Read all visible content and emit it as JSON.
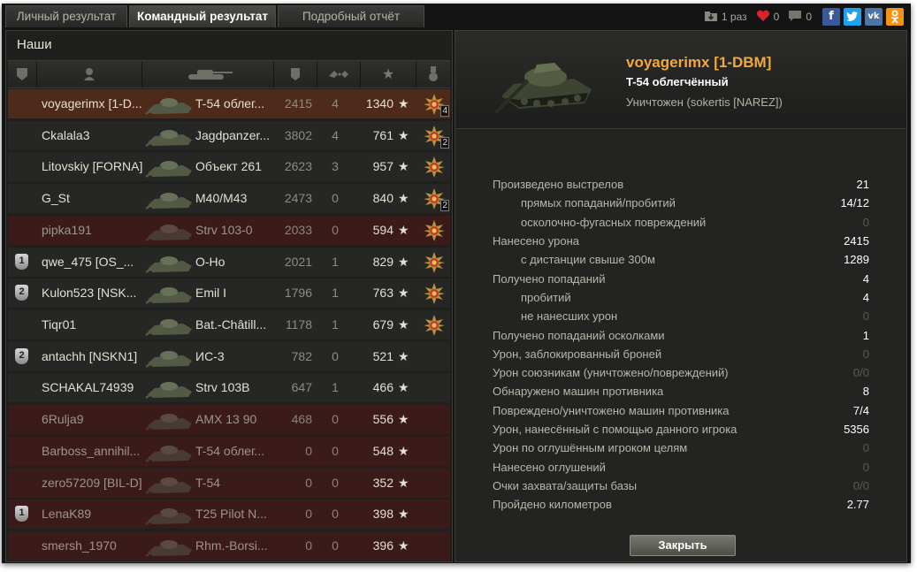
{
  "tabs": [
    "Личный результат",
    "Командный результат",
    "Подробный отчёт"
  ],
  "topbar": {
    "replay_count": "1 раз",
    "likes": "0",
    "comments": "0"
  },
  "team_title": "Наши",
  "players": [
    {
      "name": "voyagerimx [1-D...",
      "vehicle": "T-54 облег...",
      "damage": "2415",
      "frags": "4",
      "xp": "1340",
      "medal": "4",
      "badge": "",
      "status": "selected"
    },
    {
      "name": "Ckalala3",
      "vehicle": "Jagdpanzer...",
      "damage": "3802",
      "frags": "4",
      "xp": "761",
      "medal": "2",
      "badge": "",
      "status": "alive"
    },
    {
      "name": "Litovskiy [FORNA]",
      "vehicle": "Объект 261",
      "damage": "2623",
      "frags": "3",
      "xp": "957",
      "medal": "",
      "badge": "",
      "status": "alive"
    },
    {
      "name": "G_St",
      "vehicle": "M40/M43",
      "damage": "2473",
      "frags": "0",
      "xp": "840",
      "medal": "2",
      "badge": "",
      "status": "alive"
    },
    {
      "name": "pipka191",
      "vehicle": "Strv 103-0",
      "damage": "2033",
      "frags": "0",
      "xp": "594",
      "medal": "",
      "badge": "",
      "status": "dead"
    },
    {
      "name": "qwe_475 [OS_...",
      "vehicle": "O-Ho",
      "damage": "2021",
      "frags": "1",
      "xp": "829",
      "medal": "",
      "badge": "1",
      "status": "alive"
    },
    {
      "name": "Kulon523 [NSK...",
      "vehicle": "Emil I",
      "damage": "1796",
      "frags": "1",
      "xp": "763",
      "medal": "",
      "badge": "2",
      "status": "alive"
    },
    {
      "name": "Tiqr01",
      "vehicle": "Bat.-Châtill...",
      "damage": "1178",
      "frags": "1",
      "xp": "679",
      "medal": "",
      "badge": "",
      "status": "alive"
    },
    {
      "name": "antachh [NSKN1]",
      "vehicle": "ИС-3",
      "damage": "782",
      "frags": "0",
      "xp": "521",
      "medal": "none",
      "badge": "2",
      "status": "alive"
    },
    {
      "name": "SCHAKAL74939",
      "vehicle": "Strv 103B",
      "damage": "647",
      "frags": "1",
      "xp": "466",
      "medal": "none",
      "badge": "",
      "status": "alive"
    },
    {
      "name": "6Rulja9",
      "vehicle": "AMX 13 90",
      "damage": "468",
      "frags": "0",
      "xp": "556",
      "medal": "none",
      "badge": "",
      "status": "dead"
    },
    {
      "name": "Barboss_annihil...",
      "vehicle": "T-54 облег...",
      "damage": "0",
      "frags": "0",
      "xp": "548",
      "medal": "none",
      "badge": "",
      "status": "dead"
    },
    {
      "name": "zero57209 [BIL-D]",
      "vehicle": "T-54",
      "damage": "0",
      "frags": "0",
      "xp": "352",
      "medal": "none",
      "badge": "",
      "status": "dead"
    },
    {
      "name": "LenaK89",
      "vehicle": "T25 Pilot N...",
      "damage": "0",
      "frags": "0",
      "xp": "398",
      "medal": "none",
      "badge": "1",
      "status": "dead"
    },
    {
      "name": "smersh_1970",
      "vehicle": "Rhm.-Borsi...",
      "damage": "0",
      "frags": "0",
      "xp": "396",
      "medal": "none",
      "badge": "",
      "status": "dead"
    }
  ],
  "detail": {
    "player": "voyagerimx [1-DBM]",
    "vehicle": "T-54 облегчённый",
    "killed_by": "Уничтожен (sokertis [NAREZ])",
    "stats": [
      {
        "label": "Произведено выстрелов",
        "value": "21",
        "sub": false
      },
      {
        "label": "прямых попаданий/пробитий",
        "value": "14/12",
        "sub": true
      },
      {
        "label": "осколочно-фугасных повреждений",
        "value": "0",
        "sub": true
      },
      {
        "label": "Нанесено урона",
        "value": "2415",
        "sub": false
      },
      {
        "label": "с дистанции свыше 300м",
        "value": "1289",
        "sub": true
      },
      {
        "label": "Получено попаданий",
        "value": "4",
        "sub": false
      },
      {
        "label": "пробитий",
        "value": "4",
        "sub": true
      },
      {
        "label": "не нанесших урон",
        "value": "0",
        "sub": true
      },
      {
        "label": "Получено попаданий осколками",
        "value": "1",
        "sub": false
      },
      {
        "label": "Урон, заблокированный броней",
        "value": "0",
        "sub": false
      },
      {
        "label": "Урон союзникам (уничтожено/повреждений)",
        "value": "0/0",
        "sub": false
      },
      {
        "label": "Обнаружено машин противника",
        "value": "8",
        "sub": false
      },
      {
        "label": "Повреждено/уничтожено машин противника",
        "value": "7/4",
        "sub": false
      },
      {
        "label": "Урон, нанесённый с помощью данного игрока",
        "value": "5356",
        "sub": false
      },
      {
        "label": "Урон по оглушённым игроком целям",
        "value": "0",
        "sub": false
      },
      {
        "label": "Нанесено оглушений",
        "value": "0",
        "sub": false
      },
      {
        "label": "Очки захвата/защиты базы",
        "value": "0/0",
        "sub": false
      },
      {
        "label": "Пройдено километров",
        "value": "2.77",
        "sub": false
      }
    ],
    "close_label": "Закрыть"
  },
  "colors": {
    "accent_name": "#f3a83b",
    "dead_row": "#3a1b19",
    "selected_row": "#4e2a1b"
  }
}
